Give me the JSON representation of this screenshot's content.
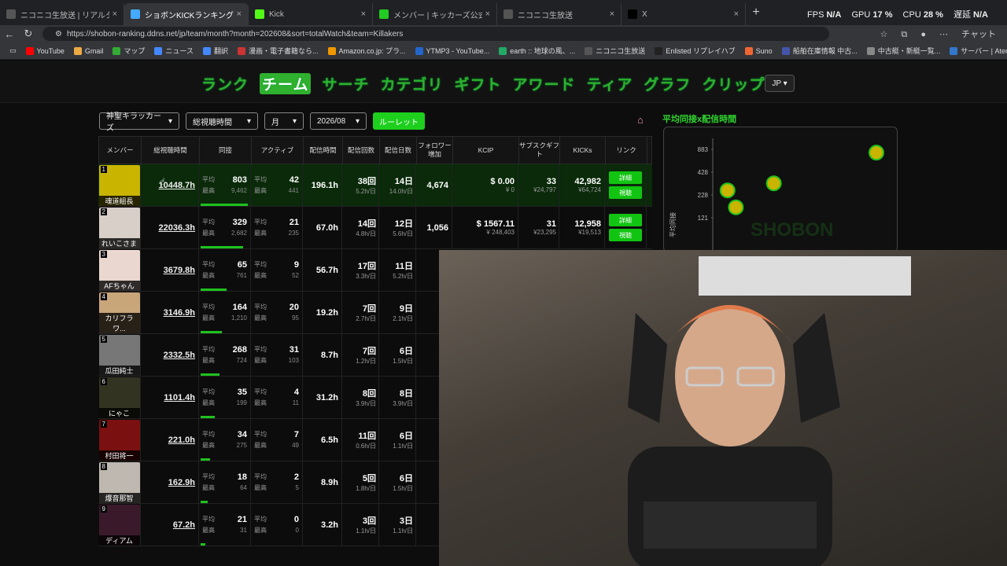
{
  "browser": {
    "tabs": [
      {
        "title": "ニコニコ生放送 | リアルタイムランキング",
        "color": "#555",
        "active": false
      },
      {
        "title": "ショボンKICKランキング | Shobon Kick",
        "color": "#4af",
        "active": true
      },
      {
        "title": "Kick",
        "color": "#53fc18",
        "active": false
      },
      {
        "title": "メンバー | キッカーズ公式サイト",
        "color": "#2c2",
        "active": false
      },
      {
        "title": "ニコニコ生放送",
        "color": "#555",
        "active": false
      },
      {
        "title": "X",
        "color": "#000",
        "active": false
      }
    ],
    "sysinfo": {
      "fps_label": "FPS",
      "fps": "N/A",
      "gpu_label": "GPU",
      "gpu": "17 %",
      "cpu_label": "CPU",
      "cpu": "28 %",
      "lat_label": "遅延",
      "lat": "N/A"
    },
    "url": "https://shobon-ranking.ddns.net/jp/team/month?month=202608&sort=totalWatch&team=Killakers",
    "chat_label": "チャット",
    "bookmarks": [
      {
        "label": "YouTube",
        "color": "#f00"
      },
      {
        "label": "Gmail",
        "color": "#ea4"
      },
      {
        "label": "マップ",
        "color": "#3a3"
      },
      {
        "label": "ニュース",
        "color": "#48f"
      },
      {
        "label": "翻訳",
        "color": "#48f"
      },
      {
        "label": "漫画・電子書籍なら...",
        "color": "#c33"
      },
      {
        "label": "Amazon.co.jp: プラ...",
        "color": "#e90"
      },
      {
        "label": "YTMP3 - YouTube...",
        "color": "#26c"
      },
      {
        "label": "earth :: 地球の風、...",
        "color": "#2a6"
      },
      {
        "label": "ニコニコ生放送",
        "color": "#555"
      },
      {
        "label": "Enlisted リプレイハブ",
        "color": "#222"
      },
      {
        "label": "Suno",
        "color": "#e63"
      },
      {
        "label": "船舶在庫情報 中古...",
        "color": "#45a"
      },
      {
        "label": "中古艇・新艇一覧...",
        "color": "#888"
      },
      {
        "label": "サーバー | Aternos |...",
        "color": "#37c"
      }
    ]
  },
  "site": {
    "nav": [
      "ランク",
      "チーム",
      "サーチ",
      "カテゴリ",
      "ギフト",
      "アワード",
      "ティア",
      "グラフ",
      "クリップ"
    ],
    "nav_selected": 1,
    "lang": "JP ▾",
    "filters": {
      "team": "神聖キラッカーズ",
      "sort": "総視聴時間",
      "period": "月",
      "month": "2026/08",
      "roulette": "ルーレット"
    },
    "headers": [
      "メンバー",
      "総視聴時間",
      "同接",
      "アクティブ",
      "配信時間",
      "配信回数",
      "配信日数",
      "フォロワー増加",
      "KCIP",
      "サブスクギフト",
      "KICKs",
      "リンク"
    ],
    "labels": {
      "avg": "平均",
      "max": "最高",
      "detail": "詳細",
      "watch": "視聴"
    },
    "rows": [
      {
        "rank": "1",
        "name": "魂道組長",
        "total": "10448.7h",
        "cc_avg": "803",
        "cc_max": "9,462",
        "act_avg": "42",
        "act_max": "441",
        "hours": "196.1h",
        "count": "38回",
        "count_sub": "5.2h/日",
        "days": "14日",
        "days_sub": "14.0h/日",
        "follow": "4,674",
        "kcip": "$ 0.00",
        "kcip_sub": "¥ 0",
        "subs": "33",
        "subs_sub": "¥24,797",
        "kicks": "42,982",
        "kicks_sub": "¥64,724",
        "bar": 1.0,
        "bg": "#c9b400"
      },
      {
        "rank": "2",
        "name": "れいこさま",
        "total": "22036.3h",
        "cc_avg": "329",
        "cc_max": "2,682",
        "act_avg": "21",
        "act_max": "235",
        "hours": "67.0h",
        "count": "14回",
        "count_sub": "4.8h/日",
        "days": "12日",
        "days_sub": "5.6h/日",
        "follow": "1,056",
        "kcip": "$ 1567.11",
        "kcip_sub": "¥ 248,403",
        "subs": "31",
        "subs_sub": "¥23,295",
        "kicks": "12,958",
        "kicks_sub": "¥19,513",
        "bar": 0.9,
        "bg": "#d8cfc8"
      },
      {
        "rank": "3",
        "name": "AFちゃん",
        "total": "3679.8h",
        "cc_avg": "65",
        "cc_max": "761",
        "act_avg": "9",
        "act_max": "52",
        "hours": "56.7h",
        "count": "17回",
        "count_sub": "3.3h/日",
        "days": "11日",
        "days_sub": "5.2h/日",
        "bar": 0.55,
        "bg": "#e9d7d0"
      },
      {
        "rank": "4",
        "name": "カリフラワ...",
        "total": "3146.9h",
        "cc_avg": "164",
        "cc_max": "1,210",
        "act_avg": "20",
        "act_max": "95",
        "hours": "19.2h",
        "count": "7回",
        "count_sub": "2.7h/日",
        "days": "9日",
        "days_sub": "2.1h/日",
        "bar": 0.45,
        "bg": "#c9a57a"
      },
      {
        "rank": "5",
        "name": "瓜田純士",
        "total": "2332.5h",
        "cc_avg": "268",
        "cc_max": "724",
        "act_avg": "31",
        "act_max": "103",
        "hours": "8.7h",
        "count": "7回",
        "count_sub": "1.2h/日",
        "days": "6日",
        "days_sub": "1.5h/日",
        "bar": 0.4,
        "bg": "#777"
      },
      {
        "rank": "6",
        "name": "にゃこ",
        "total": "1101.4h",
        "cc_avg": "35",
        "cc_max": "199",
        "act_avg": "4",
        "act_max": "11",
        "hours": "31.2h",
        "count": "8回",
        "count_sub": "3.9h/日",
        "days": "8日",
        "days_sub": "3.9h/日",
        "bar": 0.3,
        "bg": "#332"
      },
      {
        "rank": "7",
        "name": "村田将一",
        "total": "221.0h",
        "cc_avg": "34",
        "cc_max": "275",
        "act_avg": "7",
        "act_max": "49",
        "hours": "6.5h",
        "count": "11回",
        "count_sub": "0.6h/日",
        "days": "6日",
        "days_sub": "1.1h/日",
        "bar": 0.2,
        "bg": "#7a1010"
      },
      {
        "rank": "8",
        "name": "爆音那智",
        "total": "162.9h",
        "cc_avg": "18",
        "cc_max": "64",
        "act_avg": "2",
        "act_max": "5",
        "hours": "8.9h",
        "count": "5回",
        "count_sub": "1.8h/日",
        "days": "6日",
        "days_sub": "1.5h/日",
        "bar": 0.15,
        "bg": "#bfb8b0"
      },
      {
        "rank": "9",
        "name": "ディアム",
        "total": "67.2h",
        "cc_avg": "21",
        "cc_max": "31",
        "act_avg": "0",
        "act_max": "0",
        "hours": "3.2h",
        "count": "3回",
        "count_sub": "1.1h/日",
        "days": "3日",
        "days_sub": "1.1h/日",
        "bar": 0.1,
        "bg": "#3a1a2a"
      }
    ]
  },
  "chart_data": {
    "type": "scatter",
    "title": "平均同接x配信時間",
    "ylabel": "平均同接",
    "y_ticks": [
      "883",
      "428",
      "228",
      "121"
    ],
    "watermark": "SHOBON",
    "points": [
      {
        "x": 196.1,
        "y": 803
      },
      {
        "x": 67.0,
        "y": 329
      },
      {
        "x": 8.7,
        "y": 268
      },
      {
        "x": 19.2,
        "y": 164
      }
    ]
  }
}
